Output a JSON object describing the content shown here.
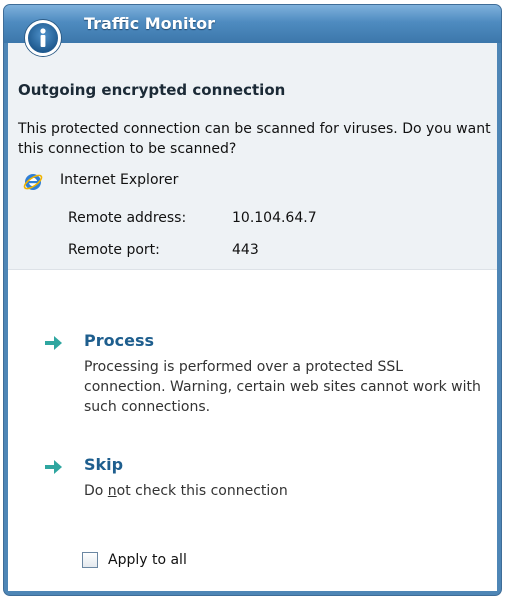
{
  "window": {
    "title": "Traffic Monitor",
    "icon": "info-icon"
  },
  "info": {
    "heading": "Outgoing encrypted connection",
    "description": "This protected connection can be scanned for viruses. Do you want this connection to be scanned?",
    "application": {
      "icon": "internet-explorer-icon",
      "name": "Internet Explorer"
    },
    "remote_address_label": "Remote address:",
    "remote_address_value": "10.104.64.7",
    "remote_port_label": "Remote port:",
    "remote_port_value": "443"
  },
  "options": [
    {
      "icon": "arrow-right-icon",
      "title": "Process",
      "description": "Processing is performed over a protected SSL connection. Warning, certain web sites cannot work with such connections."
    },
    {
      "icon": "arrow-right-icon",
      "title": "Skip",
      "description_pre": "Do ",
      "description_underlined": "n",
      "description_post": "ot check this connection"
    }
  ],
  "apply_to_all": {
    "label": "Apply to all",
    "checked": false
  },
  "colors": {
    "title_bar": "#4e8bc0",
    "option_title": "#1e5e8e",
    "arrow": "#2fa6a0"
  }
}
